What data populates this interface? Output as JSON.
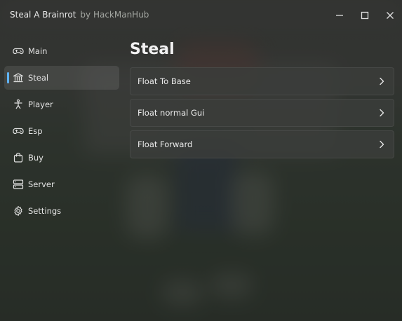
{
  "window": {
    "title": "Steal A Brainrot",
    "subtitle": "by HackManHub"
  },
  "sidebar": {
    "items": [
      {
        "label": "Main",
        "icon": "gamepad-icon",
        "active": false
      },
      {
        "label": "Steal",
        "icon": "bank-icon",
        "active": true
      },
      {
        "label": "Player",
        "icon": "person-icon",
        "active": false
      },
      {
        "label": "Esp",
        "icon": "gamepad-icon",
        "active": false
      },
      {
        "label": "Buy",
        "icon": "shopping-bag-icon",
        "active": false
      },
      {
        "label": "Server",
        "icon": "server-icon",
        "active": false
      },
      {
        "label": "Settings",
        "icon": "gear-icon",
        "active": false
      }
    ]
  },
  "main": {
    "title": "Steal",
    "options": [
      {
        "label": "Float To Base"
      },
      {
        "label": "Float normal Gui"
      },
      {
        "label": "Float Forward"
      }
    ]
  },
  "colors": {
    "accent": "#5fb3f6",
    "text": "#e2e2e2"
  }
}
